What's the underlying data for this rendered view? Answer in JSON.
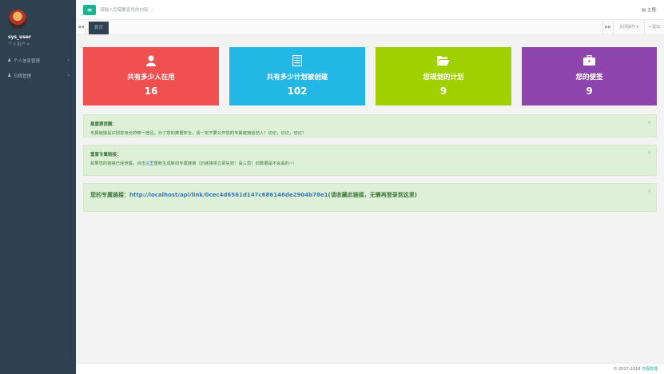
{
  "sidebar": {
    "user_name": "sys_user",
    "user_role": "个人用户 ▾",
    "items": [
      {
        "label": "个人信息管理",
        "icon": "user-icon"
      },
      {
        "label": "日程管理",
        "icon": "user-icon"
      }
    ]
  },
  "topbar": {
    "menu_icon": "hamburger-icon",
    "search_placeholder": "请输入您需要查找的内容 ...",
    "theme_label": "主题"
  },
  "tabs": {
    "active": "首页",
    "close_label": "关闭操作 ▾",
    "logout_label": "退出"
  },
  "cards": [
    {
      "title": "共有多少人在用",
      "value": "16",
      "icon": "user-icon",
      "color": "#f05050"
    },
    {
      "title": "共有多少计划被创建",
      "value": "102",
      "icon": "list-icon",
      "color": "#23b7e5"
    },
    {
      "title": "您规划的计划",
      "value": "9",
      "icon": "folder-open-icon",
      "color": "#a0d000"
    },
    {
      "title": "您的便签",
      "value": "9",
      "icon": "briefcase-icon",
      "color": "#8e44ad"
    }
  ],
  "alerts": [
    {
      "title": "最重要提醒：",
      "text": "专属链接是识别您身份的唯一途径，为了您的数据安全，请一定不要公开您的专属链接给他人！切记，切记，切记！"
    },
    {
      "title": "重置专属链接：",
      "text_before": "如果您的链接已经泄露，点击",
      "link": "这里",
      "text_after": "重新生成新的专属链接（旧链接将立即失效！请三思！旧数据是不会丢的~）"
    },
    {
      "label": "您的专属链接：",
      "url": "http://localhost/api/link/0cec4d6561d147c686146de2904b78e1",
      "note": "(请收藏此链接，无需再登录到这里)"
    }
  ],
  "footer": {
    "text": "© 2017-2018 ",
    "link": "日程管理"
  }
}
